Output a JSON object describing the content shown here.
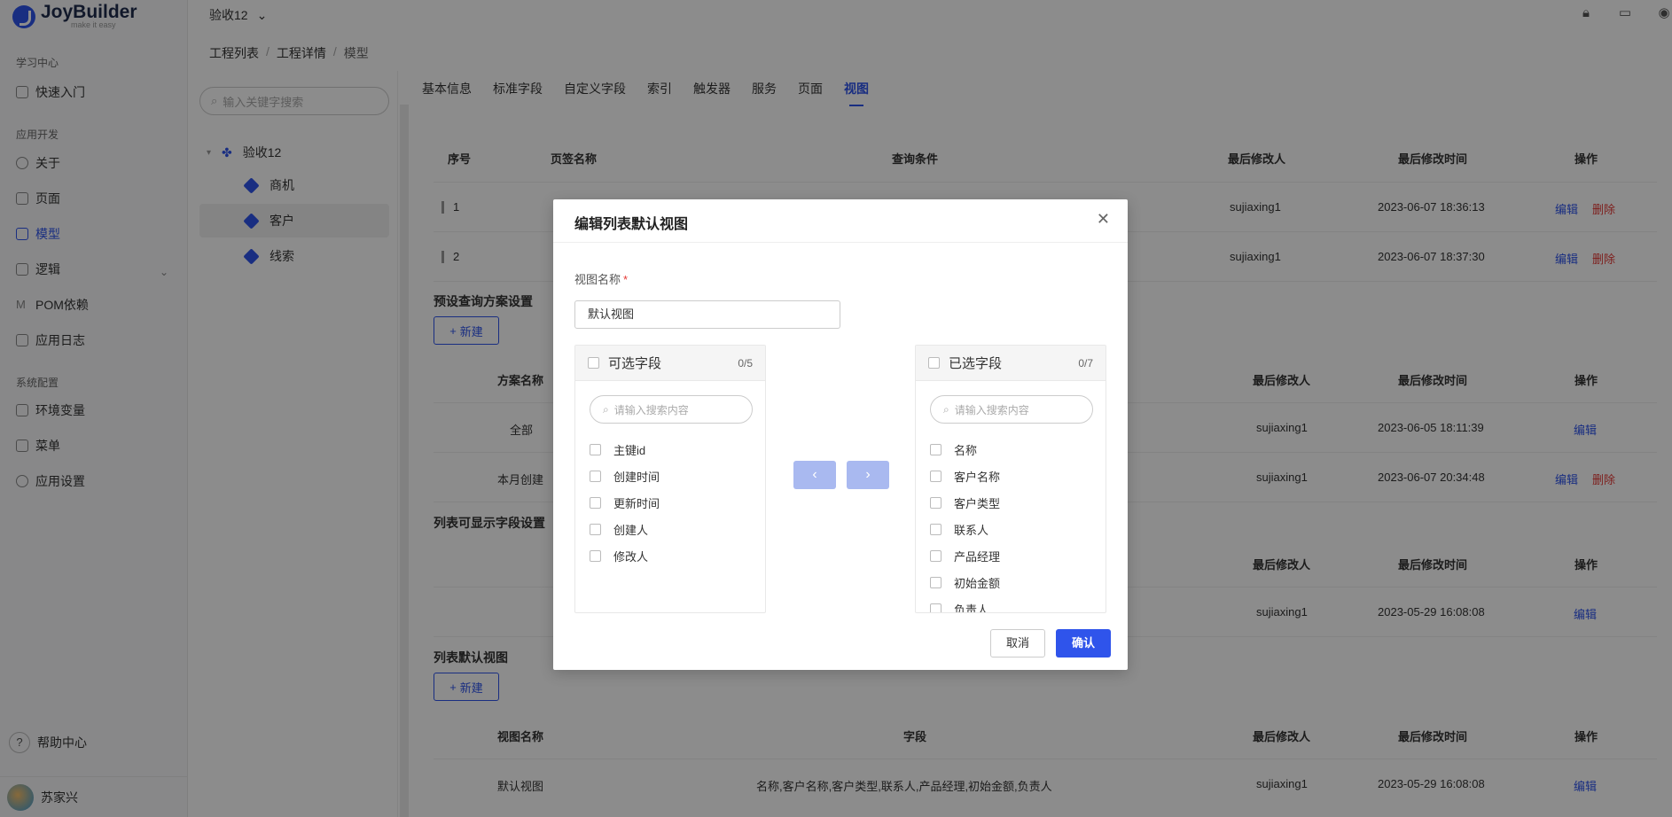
{
  "app": {
    "name": "JoyBuilder",
    "slogan": "make it easy"
  },
  "header": {
    "project": "验收12"
  },
  "sidebar": {
    "groups": [
      "学习中心",
      "应用开发",
      "系统配置"
    ],
    "items": [
      {
        "label": "快速入门"
      },
      {
        "label": "关于"
      },
      {
        "label": "页面"
      },
      {
        "label": "模型"
      },
      {
        "label": "逻辑"
      },
      {
        "label": "POM依赖"
      },
      {
        "label": "应用日志"
      },
      {
        "label": "环境变量"
      },
      {
        "label": "菜单"
      },
      {
        "label": "应用设置"
      }
    ],
    "help": "帮助中心",
    "user": "苏家兴"
  },
  "breadcrumb": [
    "工程列表",
    "工程详情",
    "模型"
  ],
  "tree": {
    "search_placeholder": "输入关键字搜索",
    "root": "验收12",
    "nodes": [
      "商机",
      "客户",
      "线索"
    ]
  },
  "tabs": [
    "基本信息",
    "标准字段",
    "自定义字段",
    "索引",
    "触发器",
    "服务",
    "页面",
    "视图"
  ],
  "tabs_table": {
    "headers": [
      "序号",
      "页签名称",
      "查询条件",
      "最后修改人",
      "最后修改时间",
      "操作"
    ],
    "rows": [
      {
        "no": "1",
        "user": "sujiaxing1",
        "time": "2023-06-07 18:36:13"
      },
      {
        "no": "2",
        "user": "sujiaxing1",
        "time": "2023-06-07 18:37:30"
      }
    ]
  },
  "preset": {
    "title": "预设查询方案设置",
    "headers": [
      "方案名称",
      "最后修改人",
      "最后修改时间",
      "操作"
    ],
    "rows": [
      {
        "name": "全部",
        "user": "sujiaxing1",
        "time": "2023-06-05 18:11:39"
      },
      {
        "name": "本月创建",
        "user": "sujiaxing1",
        "time": "2023-06-07 20:34:48"
      }
    ]
  },
  "display_fields": {
    "title": "列表可显示字段设置",
    "headers": [
      "最后修改人",
      "最后修改时间",
      "操作"
    ],
    "row": {
      "user": "sujiaxing1",
      "time": "2023-05-29 16:08:08"
    }
  },
  "default_view": {
    "title": "列表默认视图",
    "headers": [
      "视图名称",
      "字段",
      "最后修改人",
      "最后修改时间",
      "操作"
    ],
    "row": {
      "name": "默认视图",
      "fields": "名称,客户名称,客户类型,联系人,产品经理,初始金额,负责人",
      "user": "sujiaxing1",
      "time": "2023-05-29 16:08:08"
    }
  },
  "actions": {
    "new": "新建",
    "edit": "编辑",
    "delete": "删除"
  },
  "modal": {
    "title": "编辑列表默认视图",
    "name_label": "视图名称",
    "name_value": "默认视图",
    "left": {
      "title": "可选字段",
      "count": "0/5",
      "search_placeholder": "请输入搜索内容",
      "items": [
        "主键id",
        "创建时间",
        "更新时间",
        "创建人",
        "修改人"
      ]
    },
    "right": {
      "title": "已选字段",
      "count": "0/7",
      "search_placeholder": "请输入搜索内容",
      "items": [
        "名称",
        "客户名称",
        "客户类型",
        "联系人",
        "产品经理",
        "初始金额",
        "负责人"
      ]
    },
    "cancel": "取消",
    "confirm": "确认"
  }
}
